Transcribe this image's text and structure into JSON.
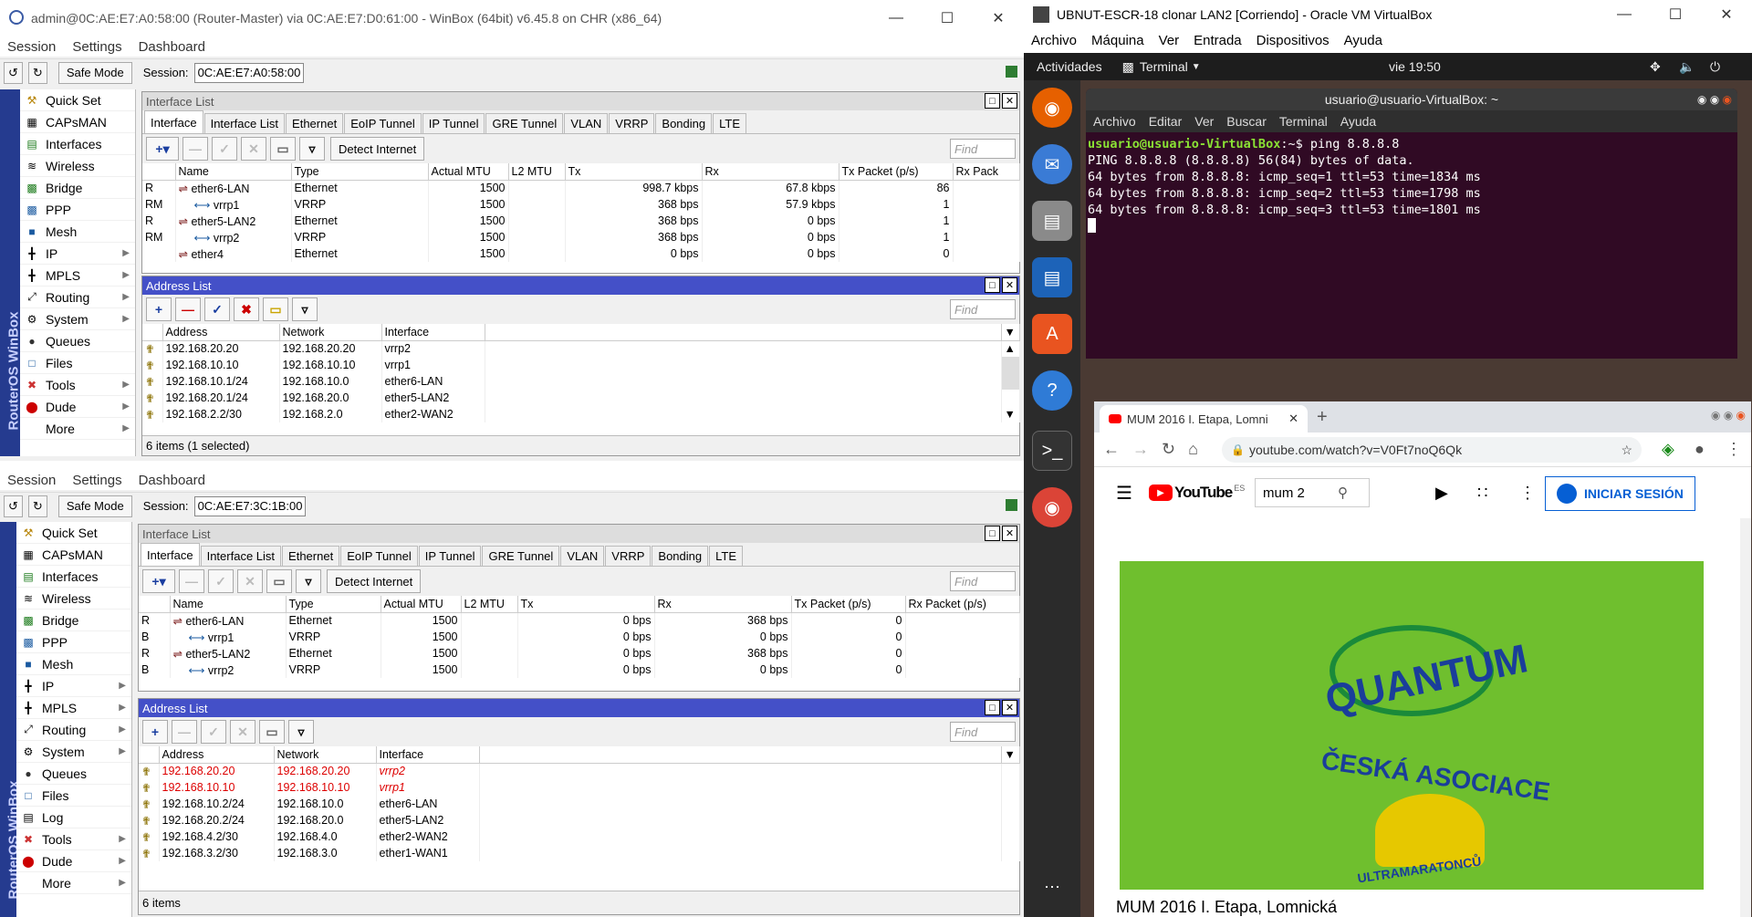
{
  "winbox_top": {
    "title": "admin@0C:AE:E7:A0:58:00 (Router-Master) via 0C:AE:E7:D0:61:00 - WinBox (64bit) v6.45.8 on CHR (x86_64)",
    "menu": [
      "Session",
      "Settings",
      "Dashboard"
    ],
    "safe_mode": "Safe Mode",
    "session_label": "Session:",
    "session_value": "0C:AE:E7:A0:58:00",
    "nav": [
      "Quick Set",
      "CAPsMAN",
      "Interfaces",
      "Wireless",
      "Bridge",
      "PPP",
      "Mesh",
      "IP",
      "MPLS",
      "Routing",
      "System",
      "Queues",
      "Files",
      "Tools",
      "Dude",
      "More"
    ],
    "brand": "RouterOS WinBox",
    "iface_title": "Interface List",
    "tabs": [
      "Interface",
      "Interface List",
      "Ethernet",
      "EoIP Tunnel",
      "IP Tunnel",
      "GRE Tunnel",
      "VLAN",
      "VRRP",
      "Bonding",
      "LTE"
    ],
    "detect": "Detect Internet",
    "find": "Find",
    "iface_cols": [
      "",
      "Name",
      "Type",
      "Actual MTU",
      "L2 MTU",
      "Tx",
      "Rx",
      "Tx Packet (p/s)",
      "Rx Pack"
    ],
    "iface_rows": [
      [
        "R",
        "ether6-LAN",
        "Ethernet",
        "1500",
        "",
        "998.7 kbps",
        "67.8 kbps",
        "86",
        ""
      ],
      [
        "RM",
        "vrrp1",
        "VRRP",
        "1500",
        "",
        "368 bps",
        "57.9 kbps",
        "1",
        ""
      ],
      [
        "R",
        "ether5-LAN2",
        "Ethernet",
        "1500",
        "",
        "368 bps",
        "0 bps",
        "1",
        ""
      ],
      [
        "RM",
        "vrrp2",
        "VRRP",
        "1500",
        "",
        "368 bps",
        "0 bps",
        "1",
        ""
      ],
      [
        "",
        "ether4",
        "Ethernet",
        "1500",
        "",
        "0 bps",
        "0 bps",
        "0",
        ""
      ]
    ],
    "addr_title": "Address List",
    "addr_cols": [
      "Address",
      "Network",
      "Interface"
    ],
    "addr_rows": [
      [
        "192.168.20.20",
        "192.168.20.20",
        "vrrp2"
      ],
      [
        "192.168.10.10",
        "192.168.10.10",
        "vrrp1"
      ],
      [
        "192.168.10.1/24",
        "192.168.10.0",
        "ether6-LAN"
      ],
      [
        "192.168.20.1/24",
        "192.168.20.0",
        "ether5-LAN2"
      ],
      [
        "192.168.2.2/30",
        "192.168.2.0",
        "ether2-WAN2"
      ]
    ],
    "addr_status": "6 items (1 selected)"
  },
  "winbox_bottom": {
    "menu": [
      "Session",
      "Settings",
      "Dashboard"
    ],
    "safe_mode": "Safe Mode",
    "session_label": "Session:",
    "session_value": "0C:AE:E7:3C:1B:00",
    "nav": [
      "Quick Set",
      "CAPsMAN",
      "Interfaces",
      "Wireless",
      "Bridge",
      "PPP",
      "Mesh",
      "IP",
      "MPLS",
      "Routing",
      "System",
      "Queues",
      "Files",
      "Log",
      "Tools",
      "Dude",
      "More"
    ],
    "brand": "RouterOS WinBox",
    "iface_title": "Interface List",
    "tabs": [
      "Interface",
      "Interface List",
      "Ethernet",
      "EoIP Tunnel",
      "IP Tunnel",
      "GRE Tunnel",
      "VLAN",
      "VRRP",
      "Bonding",
      "LTE"
    ],
    "detect": "Detect Internet",
    "find": "Find",
    "iface_cols": [
      "",
      "Name",
      "Type",
      "Actual MTU",
      "L2 MTU",
      "Tx",
      "Rx",
      "Tx Packet (p/s)",
      "Rx Packet (p/s)"
    ],
    "iface_rows": [
      [
        "R",
        "ether6-LAN",
        "Ethernet",
        "1500",
        "",
        "0 bps",
        "368 bps",
        "0",
        ""
      ],
      [
        "B",
        "vrrp1",
        "VRRP",
        "1500",
        "",
        "0 bps",
        "0 bps",
        "0",
        ""
      ],
      [
        "R",
        "ether5-LAN2",
        "Ethernet",
        "1500",
        "",
        "0 bps",
        "368 bps",
        "0",
        ""
      ],
      [
        "B",
        "vrrp2",
        "VRRP",
        "1500",
        "",
        "0 bps",
        "0 bps",
        "0",
        ""
      ]
    ],
    "addr_title": "Address List",
    "addr_cols": [
      "Address",
      "Network",
      "Interface"
    ],
    "addr_rows": [
      [
        "192.168.20.20",
        "192.168.20.20",
        "vrrp2"
      ],
      [
        "192.168.10.10",
        "192.168.10.10",
        "vrrp1"
      ],
      [
        "192.168.10.2/24",
        "192.168.10.0",
        "ether6-LAN"
      ],
      [
        "192.168.20.2/24",
        "192.168.20.0",
        "ether5-LAN2"
      ],
      [
        "192.168.4.2/30",
        "192.168.4.0",
        "ether2-WAN2"
      ],
      [
        "192.168.3.2/30",
        "192.168.3.0",
        "ether1-WAN1"
      ]
    ],
    "addr_status": "6 items"
  },
  "vbox": {
    "title": "UBNUT-ESCR-18 clonar LAN2 [Corriendo] - Oracle VM VirtualBox",
    "menu": [
      "Archivo",
      "Máquina",
      "Ver",
      "Entrada",
      "Dispositivos",
      "Ayuda"
    ],
    "activities": "Actividades",
    "app": "Terminal",
    "clock": "vie 19:50",
    "term_title": "usuario@usuario-VirtualBox: ~",
    "term_menu": [
      "Archivo",
      "Editar",
      "Ver",
      "Buscar",
      "Terminal",
      "Ayuda"
    ],
    "prompt_user": "usuario@usuario-VirtualBox",
    "prompt_rest": ":~$ ping 8.8.8.8",
    "term_lines": [
      "PING 8.8.8.8 (8.8.8.8) 56(84) bytes of data.",
      "64 bytes from 8.8.8.8: icmp_seq=1 ttl=53 time=1834 ms",
      "64 bytes from 8.8.8.8: icmp_seq=2 ttl=53 time=1798 ms",
      "64 bytes from 8.8.8.8: icmp_seq=3 ttl=53 time=1801 ms"
    ],
    "chrome_tab": "MUM 2016 I. Etapa, Lomni",
    "url": "youtube.com/watch?v=V0Ft7noQ6Qk",
    "yt_logo": "YouTube",
    "yt_region": "ES",
    "yt_search": "mum 2",
    "yt_signin": "INICIAR SESIÓN",
    "video_title": "MUM 2016 I. Etapa, Lomnická",
    "video_text1": "QUANTUM",
    "video_text2": "ČESKÁ ASOCIACE",
    "video_text3": "ULTRAMARATONCŮ"
  }
}
